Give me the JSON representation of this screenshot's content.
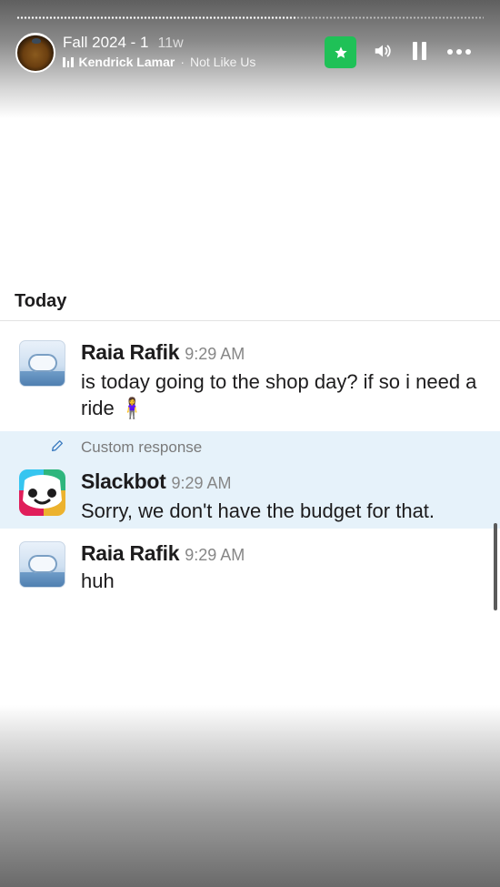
{
  "story": {
    "title": "Fall 2024 - 1",
    "age": "11w",
    "progress": 0.6,
    "music": {
      "artist": "Kendrick Lamar",
      "separator": "·",
      "song": "Not Like Us",
      "icon": "audio-bars-icon"
    },
    "controls": [
      "star-icon",
      "volume-icon",
      "pause-icon",
      "more-icon"
    ],
    "accent": "#1fc157"
  },
  "slack": {
    "day_label": "Today",
    "messages": [
      {
        "author": "Raia Rafik",
        "time": "9:29 AM",
        "text": "is today going to the shop day? if so i need a ride 🧍‍♀️"
      },
      {
        "note": "Custom response",
        "author": "Slackbot",
        "time": "9:29 AM",
        "text": "Sorry, we don't have the budget for that."
      },
      {
        "author": "Raia Rafik",
        "time": "9:29 AM",
        "text": "huh"
      }
    ],
    "highlight_color": "#e6f2fa"
  }
}
